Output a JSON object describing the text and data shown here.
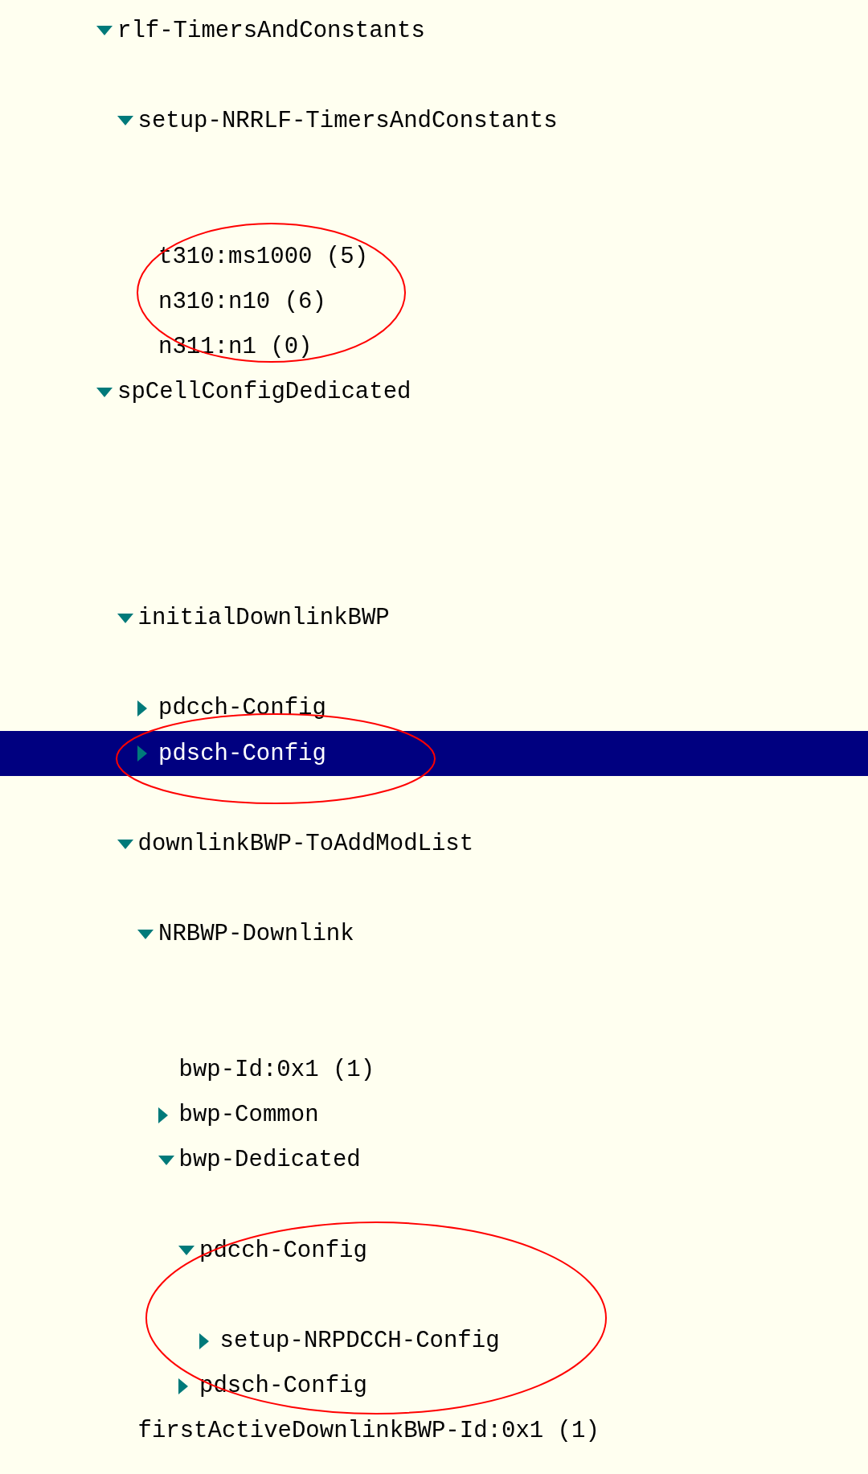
{
  "tree": [
    {
      "label": "rlf-TimersAndConstants",
      "expanded": true,
      "selected": false,
      "children": [
        {
          "label": "setup-NRRLF-TimersAndConstants",
          "expanded": true,
          "selected": false,
          "children": [
            {
              "label": "t310:ms1000 (5)",
              "selected": false
            },
            {
              "label": "n310:n10 (6)",
              "selected": false
            },
            {
              "label": "n311:n1 (0)",
              "selected": false
            }
          ]
        }
      ]
    },
    {
      "label": "spCellConfigDedicated",
      "expanded": true,
      "selected": false,
      "children": [
        {
          "label": "initialDownlinkBWP",
          "expanded": true,
          "selected": false,
          "children": [
            {
              "label": "pdcch-Config",
              "expanded": false,
              "selected": false
            },
            {
              "label": "pdsch-Config",
              "expanded": false,
              "selected": true
            }
          ]
        },
        {
          "label": "downlinkBWP-ToAddModList",
          "expanded": true,
          "selected": false,
          "children": [
            {
              "label": "NRBWP-Downlink",
              "expanded": true,
              "selected": false,
              "children": [
                {
                  "label": "bwp-Id:0x1 (1)",
                  "selected": false
                },
                {
                  "label": "bwp-Common",
                  "expanded": false,
                  "selected": false
                },
                {
                  "label": "bwp-Dedicated",
                  "expanded": true,
                  "selected": false,
                  "children": [
                    {
                      "label": "pdcch-Config",
                      "expanded": true,
                      "selected": false,
                      "children": [
                        {
                          "label": "setup-NRPDCCH-Config",
                          "expanded": false,
                          "selected": false
                        }
                      ]
                    },
                    {
                      "label": "pdsch-Config",
                      "expanded": false,
                      "selected": false
                    }
                  ]
                }
              ]
            }
          ]
        },
        {
          "label": "firstActiveDownlinkBWP-Id:0x1 (1)",
          "selected": false
        }
      ]
    }
  ],
  "annotations": [
    {
      "kind": "ellipse",
      "color": "#ff0000"
    },
    {
      "kind": "ellipse",
      "color": "#ff0000"
    },
    {
      "kind": "ellipse",
      "color": "#ff0000"
    }
  ]
}
